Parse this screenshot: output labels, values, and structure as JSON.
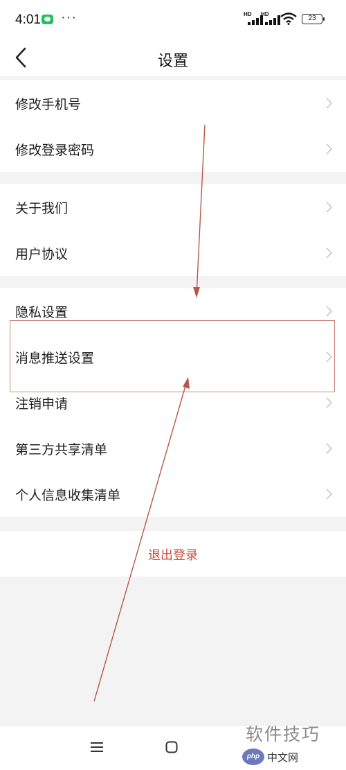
{
  "status_bar": {
    "time": "4:01",
    "more": "···",
    "signal_label": "HD",
    "battery": "23"
  },
  "header": {
    "title": "设置",
    "back_icon": "chevron-left-icon"
  },
  "groups": [
    {
      "items": [
        {
          "label": "修改手机号"
        },
        {
          "label": "修改登录密码"
        }
      ]
    },
    {
      "items": [
        {
          "label": "关于我们"
        },
        {
          "label": "用户协议"
        }
      ]
    },
    {
      "items": [
        {
          "label": "隐私设置"
        },
        {
          "label": "消息推送设置"
        },
        {
          "label": "注销申请"
        },
        {
          "label": "第三方共享清单"
        },
        {
          "label": "个人信息收集清单"
        }
      ]
    }
  ],
  "logout": {
    "label": "退出登录",
    "color": "#c44d3e"
  },
  "annotation": {
    "color": "#c9877c",
    "highlighted_item": "消息推送设置"
  },
  "bottom_nav": {
    "icons": [
      "menu-icon",
      "home-icon"
    ]
  },
  "watermark": {
    "text": "软件技巧",
    "badge": "php",
    "site": "中文网"
  }
}
